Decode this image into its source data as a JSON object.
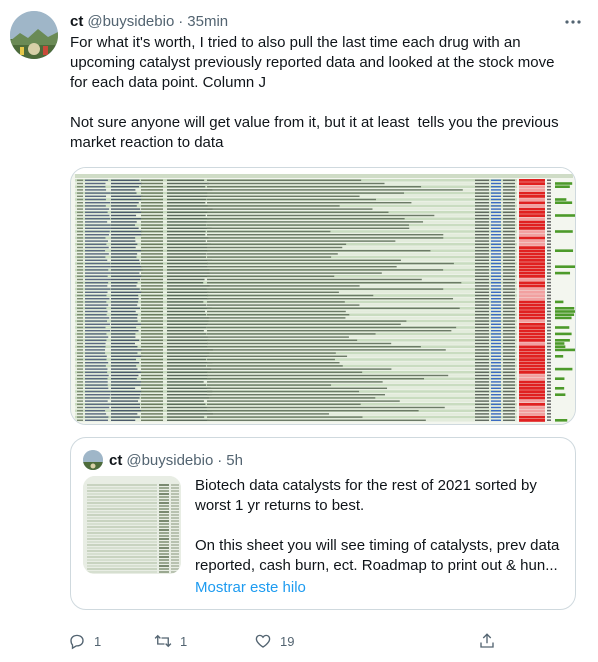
{
  "tweet": {
    "author_name": "ct",
    "handle": "@buysidebio",
    "separator": "·",
    "time": "35min",
    "text": "For what it's worth, I tried to also pull the last time each drug with an upcoming catalyst previously reported data and looked at the stock move for each data point. Column J\n\nNot sure anyone will get value from it, but it at least  tells you the previous market reaction to data",
    "icons": {
      "avatar": "avatar-photo",
      "more": "more-icon"
    }
  },
  "quote": {
    "author_name": "ct",
    "handle": "@buysidebio",
    "separator": "·",
    "time": "5h",
    "text": "Biotech data catalysts for the rest of 2021 sorted by worst 1 yr returns to best.\n\nOn this sheet you will see timing of catalysts, prev data reported, cash burn, ect. Roadmap to print out & hun...",
    "show_thread": "Mostrar este hilo"
  },
  "actions": {
    "reply_count": "1",
    "retweet_count": "1",
    "like_count": "19",
    "icons": [
      "reply-icon",
      "retweet-icon",
      "like-icon",
      "share-icon"
    ]
  },
  "colors": {
    "text_primary": "#0f1419",
    "text_secondary": "#536471",
    "link": "#1d9bf0",
    "border": "#cfd9de",
    "sheet_green": "#c9dcc0",
    "sheet_red": "#e02020",
    "sheet_bar_green": "#4c9a2a"
  }
}
